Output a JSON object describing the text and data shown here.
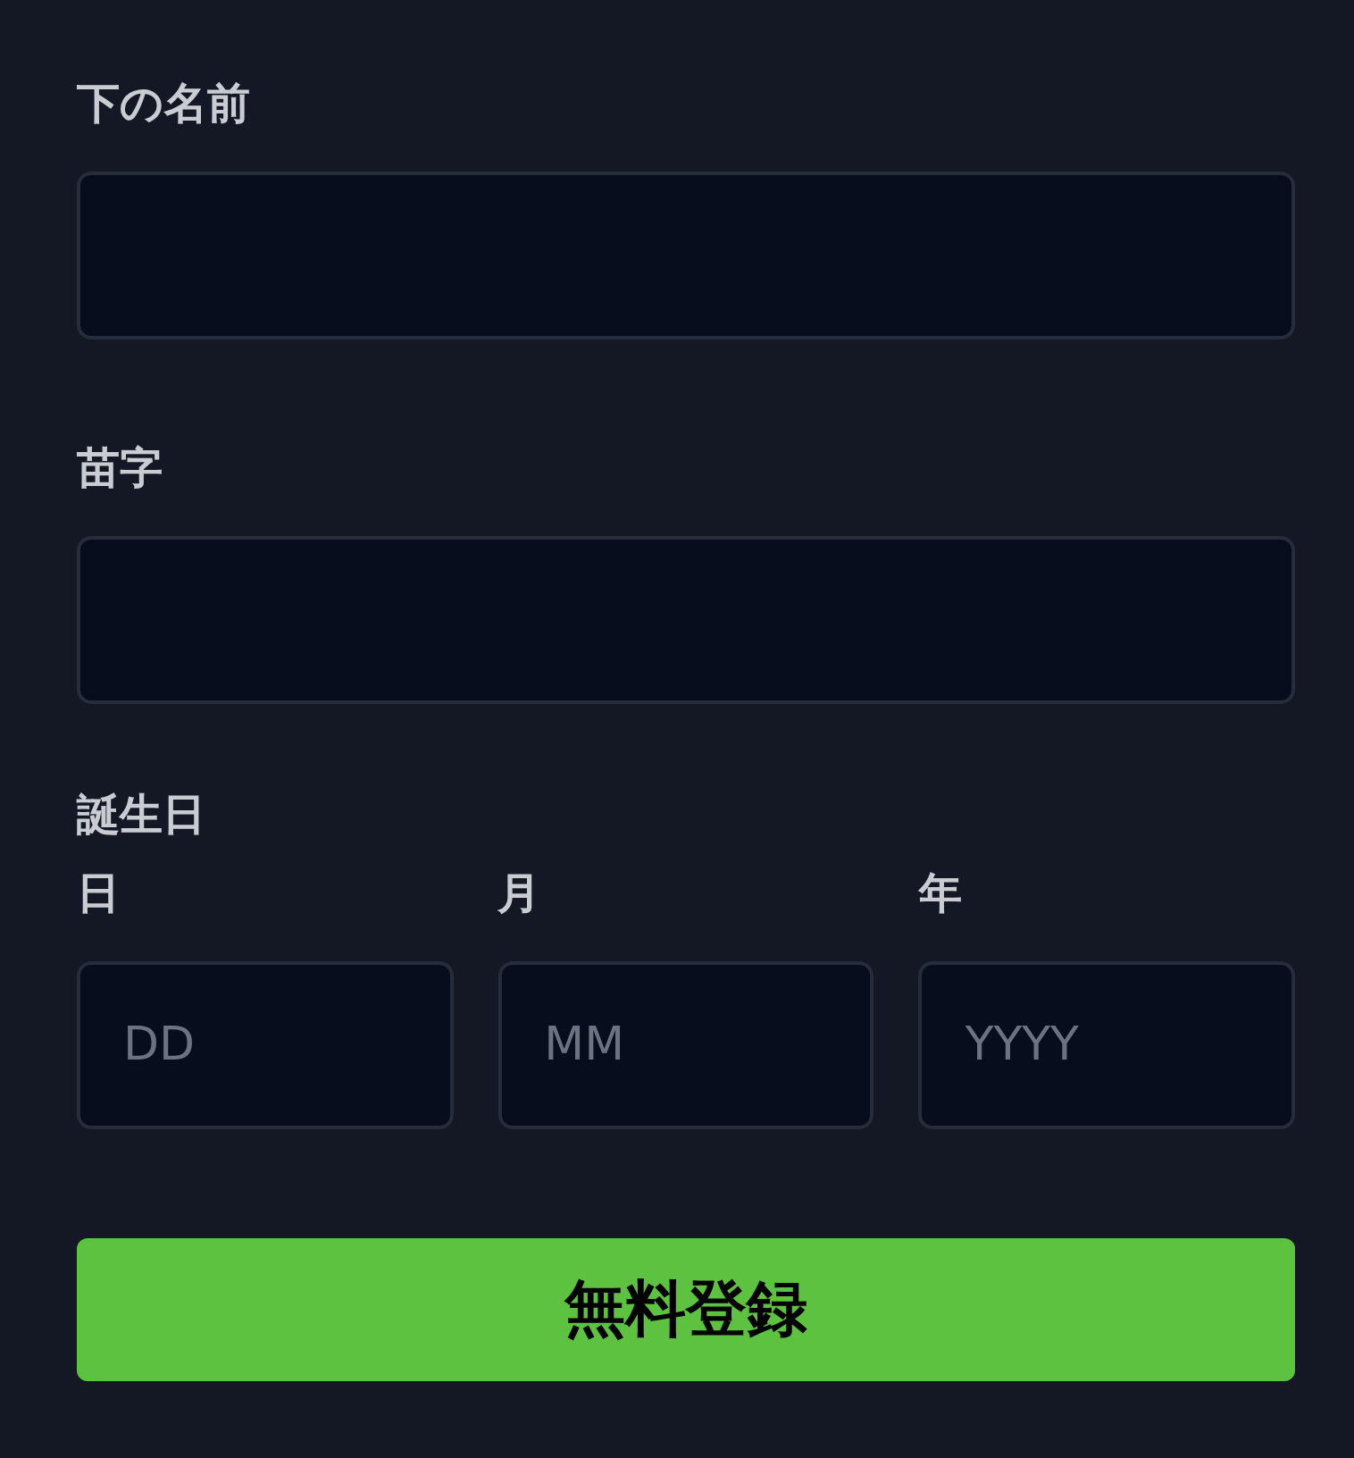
{
  "fields": [
    {
      "label": "下の名前"
    },
    {
      "label": "苗字"
    }
  ],
  "birthday": {
    "label": "誕生日",
    "parts": [
      {
        "label": "日",
        "placeholder": "DD"
      },
      {
        "label": "月",
        "placeholder": "MM"
      },
      {
        "label": "年",
        "placeholder": "YYYY"
      }
    ]
  },
  "submit": {
    "label": "無料登録"
  }
}
